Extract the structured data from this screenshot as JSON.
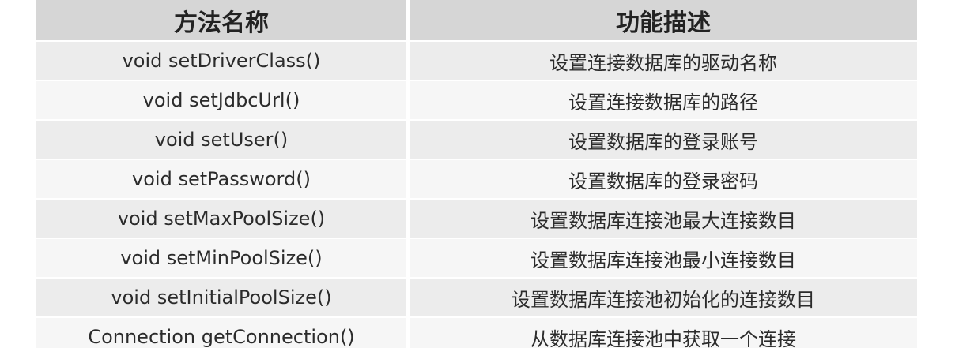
{
  "table": {
    "headers": [
      "方法名称",
      "功能描述"
    ],
    "rows": [
      {
        "method": "void setDriverClass()",
        "description": "设置连接数据库的驱动名称"
      },
      {
        "method": "void setJdbcUrl()",
        "description": "设置连接数据库的路径"
      },
      {
        "method": "void setUser()",
        "description": "设置数据库的登录账号"
      },
      {
        "method": "void setPassword()",
        "description": "设置数据库的登录密码"
      },
      {
        "method": "void setMaxPoolSize()",
        "description": "设置数据库连接池最大连接数目"
      },
      {
        "method": "void setMinPoolSize()",
        "description": "设置数据库连接池最小连接数目"
      },
      {
        "method": "void setInitialPoolSize()",
        "description": "设置数据库连接池初始化的连接数目"
      },
      {
        "method": "Connection getConnection()",
        "description": "从数据库连接池中获取一个连接"
      }
    ]
  },
  "colors": {
    "header_bg": "#d6d6d6",
    "row_bg_odd": "#ececec",
    "row_bg_even": "#f6f6f6",
    "text": "#2b2b2b"
  }
}
